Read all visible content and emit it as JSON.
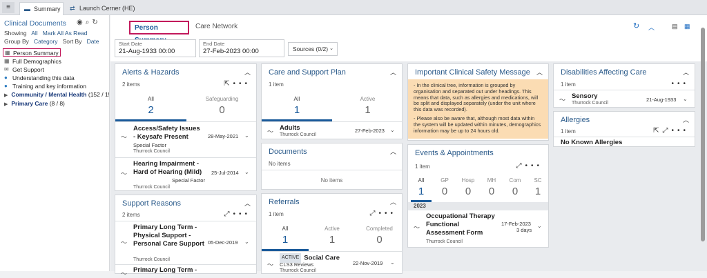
{
  "topbar": {
    "tabs": [
      {
        "label": "Summary"
      },
      {
        "label": "Launch Cerner (HE)"
      }
    ]
  },
  "left": {
    "title": "Clinical Documents",
    "showing_label": "Showing",
    "showing_value": "All",
    "mark_all": "Mark All As Read",
    "groupby_label": "Group By",
    "groupby_value": "Category",
    "sortby_label": "Sort By",
    "sortby_value": "Date",
    "docs": [
      "Person Summary",
      "Full Demographics",
      "Get Support",
      "Understanding this data",
      "Training and key information"
    ],
    "tree": [
      {
        "label": "Community / Mental Health",
        "count": "(152 / 15"
      },
      {
        "label": "Primary Care",
        "count": "(8 / 8)"
      }
    ]
  },
  "main": {
    "tabs": [
      "Person Summary",
      "Care Network"
    ],
    "start_date": {
      "label": "Start Date",
      "value": "21-Aug-1933 00:00"
    },
    "end_date": {
      "label": "End Date",
      "value": "27-Feb-2023 00:00"
    },
    "sources": "Sources (0/2)"
  },
  "alerts": {
    "title": "Alerts & Hazards",
    "count": "2 items",
    "tabs": [
      {
        "label": "All",
        "n": "2"
      },
      {
        "label": "Safeguarding",
        "n": "0"
      }
    ],
    "items": [
      {
        "title": "Access/Safety Issues - Keysafe Present",
        "sub": "Special Factor",
        "org": "Thurrock Council",
        "date": "28-May-2021"
      },
      {
        "title": "Hearing Impairment - Hard of Hearing (Mild)",
        "sub": "Special Factor",
        "org": "Thurrock Council",
        "date": "25-Jul-2014"
      }
    ]
  },
  "support": {
    "title": "Support Reasons",
    "count": "2 items",
    "items": [
      {
        "title": "Primary Long Term - Physical Support - Personal Care Support",
        "org": "Thurrock Council",
        "date": "05-Dec-2019"
      },
      {
        "title": "Primary Long Term -",
        "org": "",
        "date": ""
      }
    ]
  },
  "careplan": {
    "title": "Care and Support Plan",
    "count": "1 item",
    "tabs": [
      {
        "label": "All",
        "n": "1"
      },
      {
        "label": "Active",
        "n": "1"
      }
    ],
    "items": [
      {
        "title": "Adults",
        "org": "Thurrock Council",
        "date": "27-Feb-2023"
      }
    ]
  },
  "documents": {
    "title": "Documents",
    "count": "No items",
    "empty": "No items"
  },
  "referrals": {
    "title": "Referrals",
    "count": "1 item",
    "tabs": [
      {
        "label": "All",
        "n": "1"
      },
      {
        "label": "Active",
        "n": "1"
      },
      {
        "label": "Completed",
        "n": "0"
      }
    ],
    "items": [
      {
        "badge": "ACTIVE",
        "title": "Social Care",
        "sub": "CLS3 Reviews",
        "org": "Thurrock Council",
        "date": "22-Nov-2019"
      }
    ]
  },
  "safety": {
    "title": "Important Clinical Safety Message",
    "p1": "- In the clinical tree, information is grouped by organisation and separated out under headings. This means that data, such as allergies and medications, will be split and displayed separately (under the unit where this data was recorded).",
    "p2": "- Please also be aware that, although most data within the system will be updated within minutes, demographics information may be up to 24 hours old."
  },
  "events": {
    "title": "Events & Appointments",
    "count": "1 item",
    "tabs": [
      {
        "label": "All",
        "n": "1"
      },
      {
        "label": "GP",
        "n": "0"
      },
      {
        "label": "Hosp",
        "n": "0"
      },
      {
        "label": "MH",
        "n": "0"
      },
      {
        "label": "Com",
        "n": "0"
      },
      {
        "label": "SC",
        "n": "1"
      }
    ],
    "year": "2023",
    "items": [
      {
        "title": "Occupational Therapy Functional Assessment Form",
        "org": "Thurrock Council",
        "date": "17-Feb-2023",
        "dur": "3 days"
      }
    ]
  },
  "disabilities": {
    "title": "Disabilities Affecting Care",
    "count": "1 item",
    "items": [
      {
        "title": "Sensory",
        "org": "Thurrock Council",
        "date": "21-Aug-1933"
      }
    ]
  },
  "allergies": {
    "title": "Allergies",
    "count": "1 item",
    "text": "No Known Allergies"
  }
}
